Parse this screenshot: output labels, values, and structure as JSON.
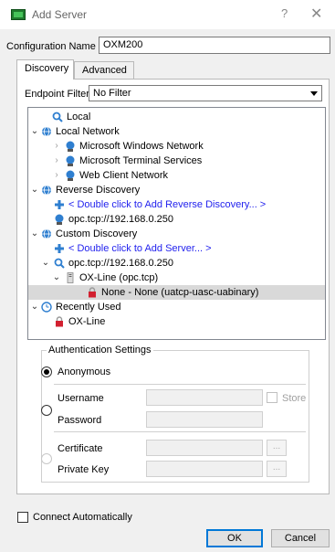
{
  "window": {
    "title": "Add Server",
    "help_glyph": "?",
    "close_glyph": "✕"
  },
  "config": {
    "label": "Configuration Name",
    "value": "OXM200"
  },
  "tabs": [
    {
      "label": "Discovery",
      "active": true
    },
    {
      "label": "Advanced",
      "active": false
    }
  ],
  "endpoint_filter": {
    "label": "Endpoint Filter:",
    "value": "No Filter"
  },
  "tree": {
    "local": "Local",
    "local_network": "Local Network",
    "ms_windows_network": "Microsoft Windows Network",
    "ms_terminal_services": "Microsoft Terminal Services",
    "web_client_network": "Web Client Network",
    "reverse_discovery": "Reverse Discovery",
    "add_reverse": "< Double click to Add Reverse Discovery... >",
    "reverse_endpoint": "opc.tcp://192.168.0.250",
    "custom_discovery": "Custom Discovery",
    "add_server": "< Double click to Add Server... >",
    "custom_endpoint": "opc.tcp://192.168.0.250",
    "ox_line_opc": "OX-Line (opc.tcp)",
    "none_none": "None - None (uatcp-uasc-uabinary)",
    "recently_used": "Recently Used",
    "ox_line": "OX-Line"
  },
  "auth": {
    "legend": "Authentication Settings",
    "anonymous": "Anonymous",
    "username": "Username",
    "store": "Store",
    "password": "Password",
    "certificate": "Certificate",
    "private_key": "Private Key",
    "browse": "..."
  },
  "footer": {
    "connect_auto": "Connect Automatically",
    "ok": "OK",
    "cancel": "Cancel"
  },
  "colors": {
    "link": "#2222ee",
    "selection": "#d9d9d9",
    "accent": "#0078d7"
  }
}
